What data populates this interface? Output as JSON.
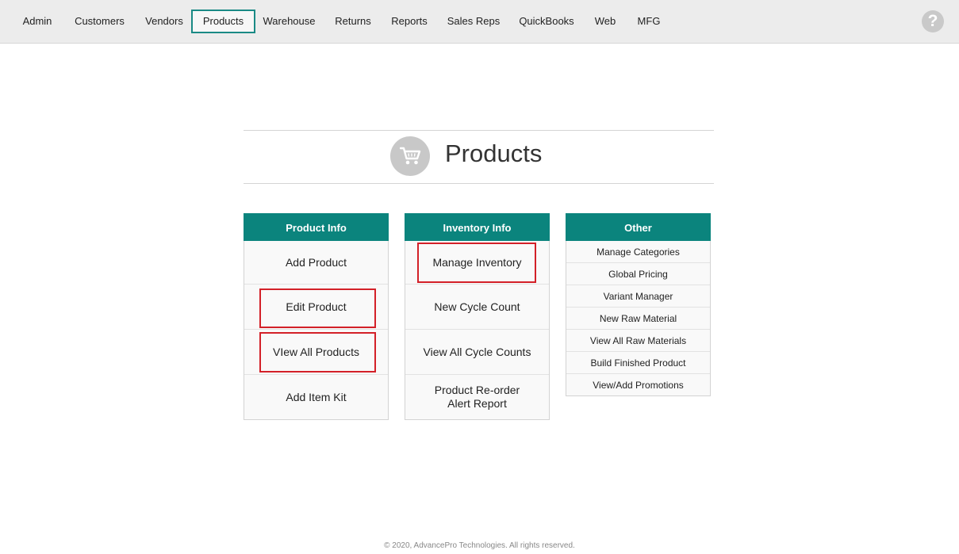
{
  "nav": {
    "items": [
      "Admin",
      "Customers",
      "Vendors",
      "Products",
      "Warehouse",
      "Returns",
      "Reports",
      "Sales Reps",
      "QuickBooks",
      "Web",
      "MFG"
    ],
    "active": "Products",
    "help_symbol": "?"
  },
  "page": {
    "title": "Products",
    "icon": "shopping-cart-icon"
  },
  "columns": {
    "product_info": {
      "header": "Product Info",
      "items": [
        "Add Product",
        "Edit Product",
        "VIew All Products",
        "Add Item Kit"
      ]
    },
    "inventory_info": {
      "header": "Inventory Info",
      "items": [
        "Manage Inventory",
        "New Cycle Count",
        "View All Cycle Counts",
        "Product  Re-order\nAlert Report"
      ]
    },
    "other": {
      "header": "Other",
      "items": [
        "Manage Categories",
        "Global Pricing",
        "Variant Manager",
        "New Raw Material",
        "View All Raw Materials",
        "Build Finished Product",
        "View/Add Promotions"
      ]
    }
  },
  "footer": "© 2020, AdvancePro Technologies. All rights reserved.",
  "colors": {
    "accent": "#0b847d",
    "highlight_box": "#d32028"
  }
}
